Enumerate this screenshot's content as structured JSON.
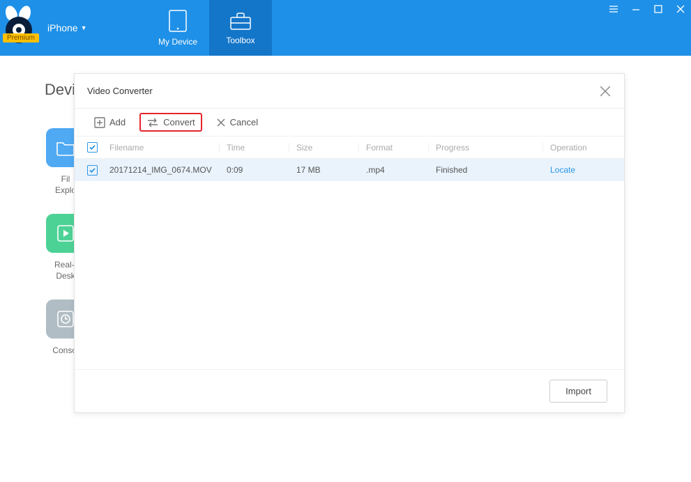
{
  "header": {
    "premium_badge": "Premium",
    "device_label": "iPhone",
    "tabs": [
      {
        "label": "My Device"
      },
      {
        "label": "Toolbox"
      }
    ]
  },
  "bg": {
    "section_title": "Devic",
    "tiles": [
      {
        "label_line1": "Fil",
        "label_line2": "Explo"
      },
      {
        "label_line1": "Real-t",
        "label_line2": "Desk"
      },
      {
        "label_line1": "Consol",
        "label_line2": ""
      }
    ]
  },
  "modal": {
    "title": "Video Converter",
    "toolbar": {
      "add_label": "Add",
      "convert_label": "Convert",
      "cancel_label": "Cancel"
    },
    "columns": {
      "filename": "Filename",
      "time": "Time",
      "size": "Size",
      "format": "Format",
      "progress": "Progress",
      "operation": "Operation"
    },
    "rows": [
      {
        "filename": "20171214_IMG_0674.MOV",
        "time": "0:09",
        "size": "17 MB",
        "format": ".mp4",
        "progress": "Finished",
        "operation": "Locate"
      }
    ],
    "footer": {
      "import_label": "Import"
    }
  }
}
